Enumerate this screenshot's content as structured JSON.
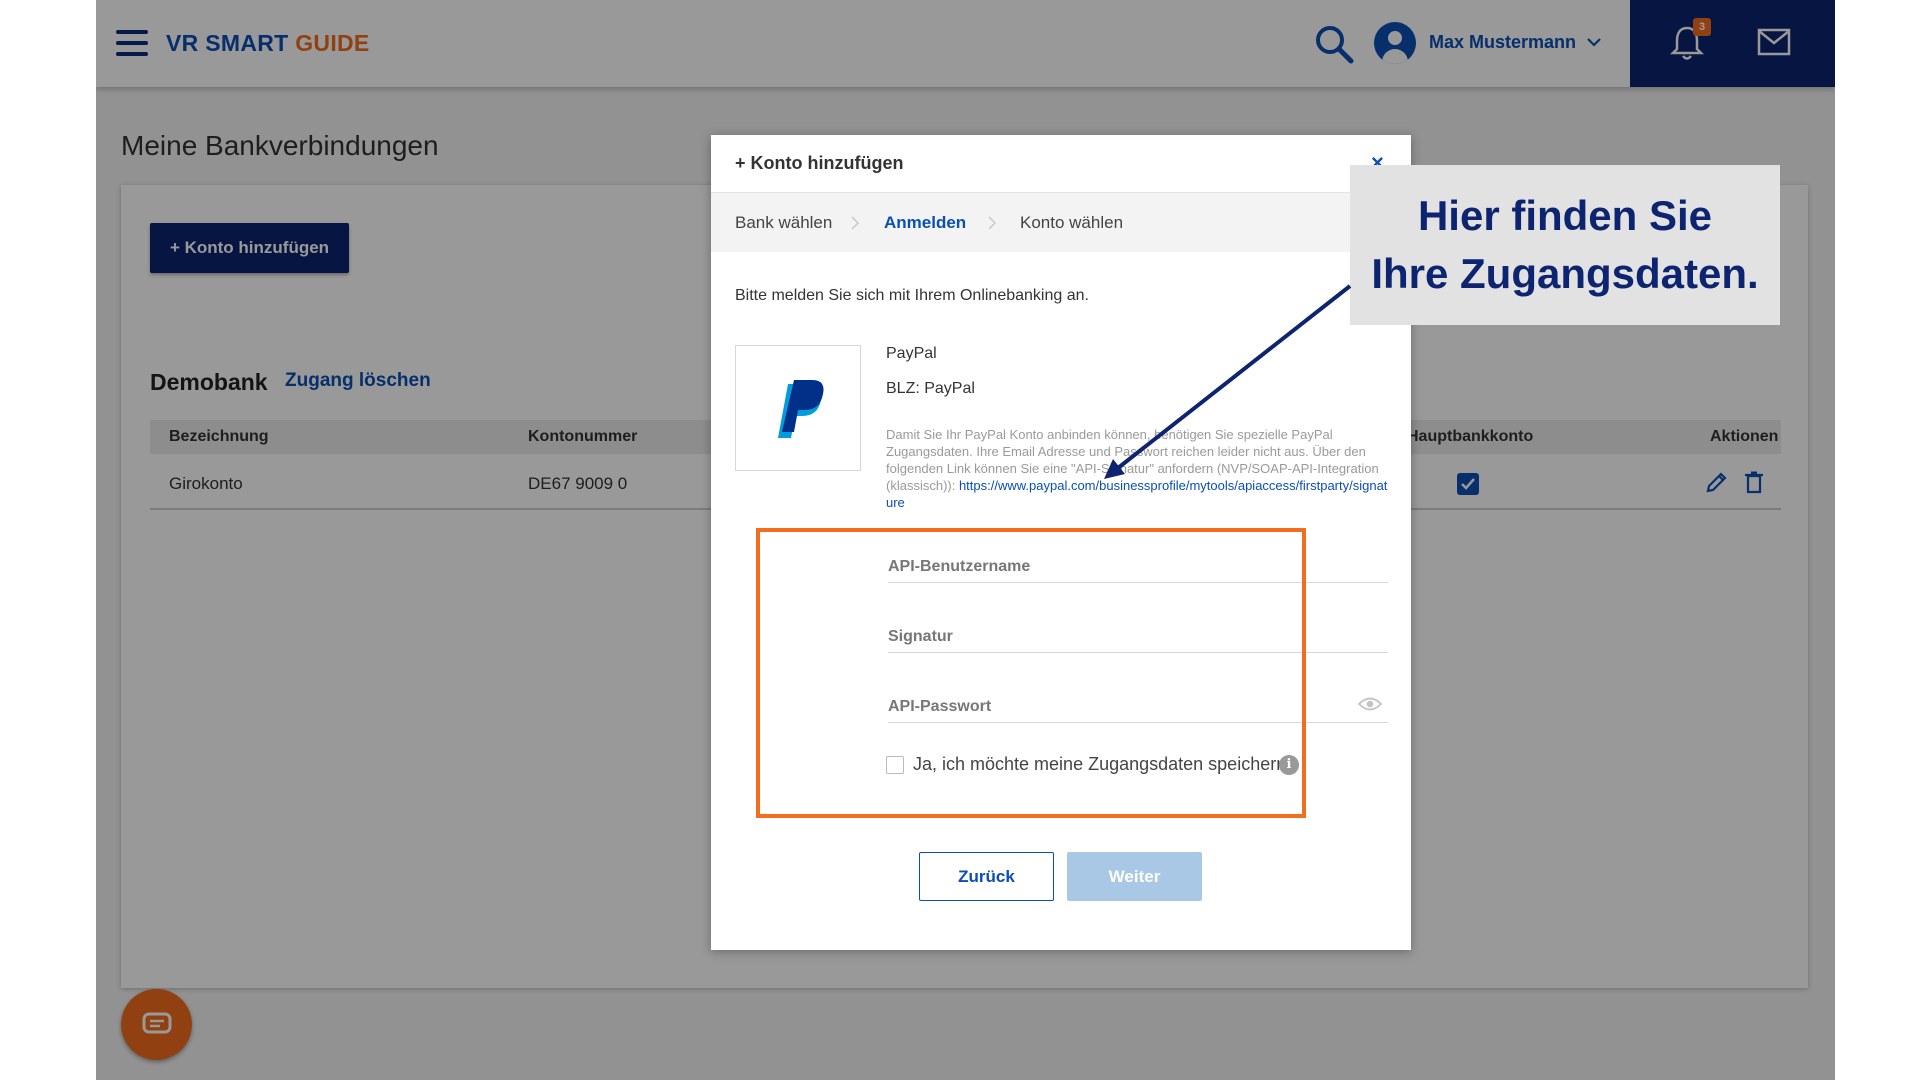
{
  "header": {
    "logo_part1": "VR SMART",
    "logo_part2": "GUIDE",
    "user_name": "Max Mustermann",
    "notification_count": "3"
  },
  "page": {
    "title": "Meine Bankverbindungen",
    "add_account_button": "+ Konto hinzufügen",
    "bank_name": "Demobank",
    "delete_access_link": "Zugang löschen",
    "table": {
      "columns": [
        "Bezeichnung",
        "Kontonummer",
        "Hauptbankkonto",
        "Aktionen"
      ],
      "rows": [
        {
          "name": "Girokonto",
          "account_number": "DE67 9009 0",
          "main_account": true
        }
      ]
    }
  },
  "modal": {
    "title": "+ Konto hinzufügen",
    "close_label": "×",
    "steps": [
      {
        "label": "Bank wählen",
        "active": false
      },
      {
        "label": "Anmelden",
        "active": true
      },
      {
        "label": "Konto wählen",
        "active": false
      }
    ],
    "intro": "Bitte melden Sie sich mit Ihrem Onlinebanking an.",
    "bank_label": "PayPal",
    "blz_label": "BLZ: PayPal",
    "help_text": "Damit Sie Ihr PayPal Konto anbinden können, benötigen Sie spezielle PayPal Zugangsdaten. Ihre Email Adresse und Passwort reichen leider nicht aus. Über den folgenden Link können Sie eine \"API-Signatur\" anfordern (NVP/SOAP-API-Integration (klassisch)): ",
    "help_link": "https://www.paypal.com/businessprofile/mytools/apiaccess/firstparty/signature",
    "fields": {
      "api_user_placeholder": "API-Benutzername",
      "signature_placeholder": "Signatur",
      "api_password_placeholder": "API-Passwort"
    },
    "save_credentials_label": "Ja, ich möchte meine Zugangsdaten speichern",
    "save_credentials_checked": false,
    "back_button": "Zurück",
    "next_button": "Weiter"
  },
  "annotation": {
    "callout_line1": "Hier finden Sie",
    "callout_line2": "Ihre Zugangsdaten."
  },
  "colors": {
    "brand_blue": "#0a4fb5",
    "navy": "#0d2470",
    "accent_orange": "#f26d1d"
  },
  "icons": [
    "menu-icon",
    "search-icon",
    "user-icon",
    "chevron-down-icon",
    "bell-icon",
    "mail-icon",
    "check-icon",
    "pencil-icon",
    "trash-icon",
    "chat-icon",
    "close-icon",
    "chevron-right-icon",
    "paypal-logo",
    "eye-icon",
    "info-icon"
  ]
}
